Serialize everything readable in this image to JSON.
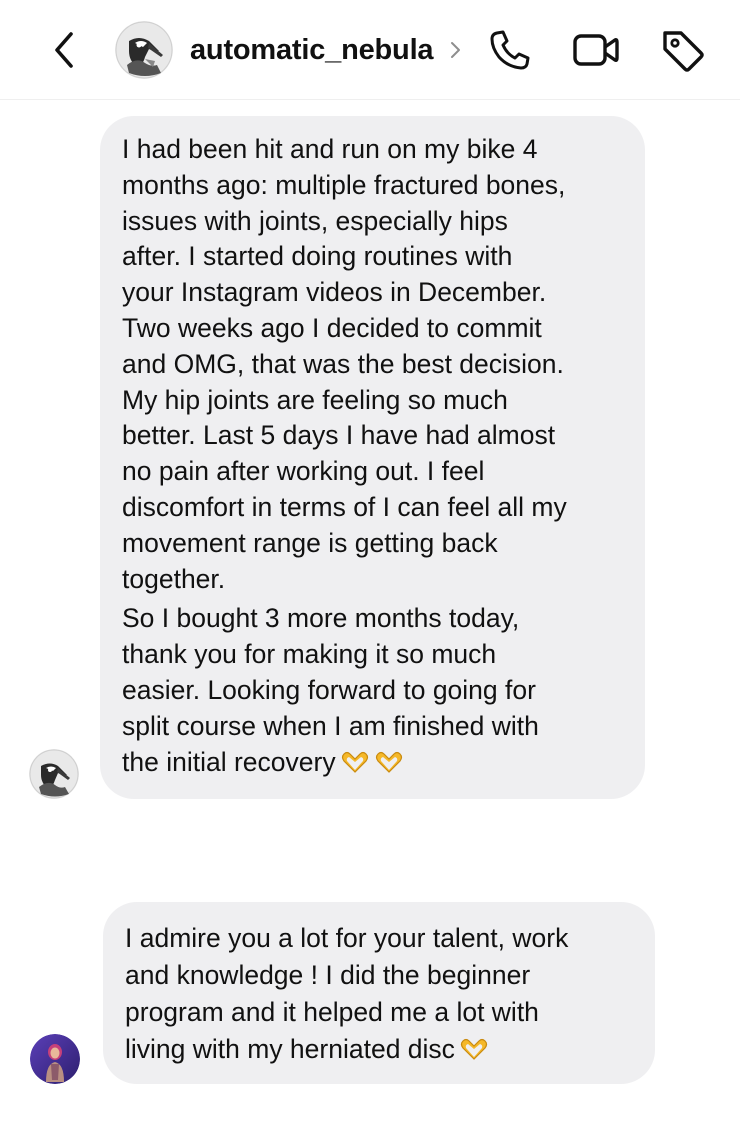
{
  "header": {
    "username": "automatic_nebula",
    "back_icon": "chevron-left-icon",
    "call_icon": "phone-icon",
    "video_icon": "video-camera-icon",
    "tag_icon": "tag-icon"
  },
  "messages": [
    {
      "sender": "automatic_nebula",
      "paragraph_1": "I had been hit and run on my bike 4\nmonths ago: multiple fractured bones,\nissues with joints, especially hips\nafter. I started doing routines with\nyour Instagram videos in December.\nTwo weeks ago I decided to commit\nand OMG, that was the best decision.\nMy hip joints are feeling so much\nbetter. Last 5 days I have had almost\nno pain after working out. I feel\ndiscomfort in terms of I can feel all my\nmovement range is getting back\ntogether.",
      "paragraph_2": "So I bought 3 more months today,\nthank you for making it so much\neasier. Looking forward to going for\nsplit course when I am finished with\nthe initial recovery",
      "emoji": "heart-hands-emoji"
    },
    {
      "sender": "other_user",
      "paragraph_1": "I admire you a lot for your talent, work\nand knowledge ! I did the beginner\nprogram and it helped me a lot with\nliving with my herniated disc",
      "emoji": "heart-hands-emoji"
    }
  ],
  "colors": {
    "bubble_background": "#efeff1",
    "text": "#111111",
    "emoji": "#f5b829"
  }
}
